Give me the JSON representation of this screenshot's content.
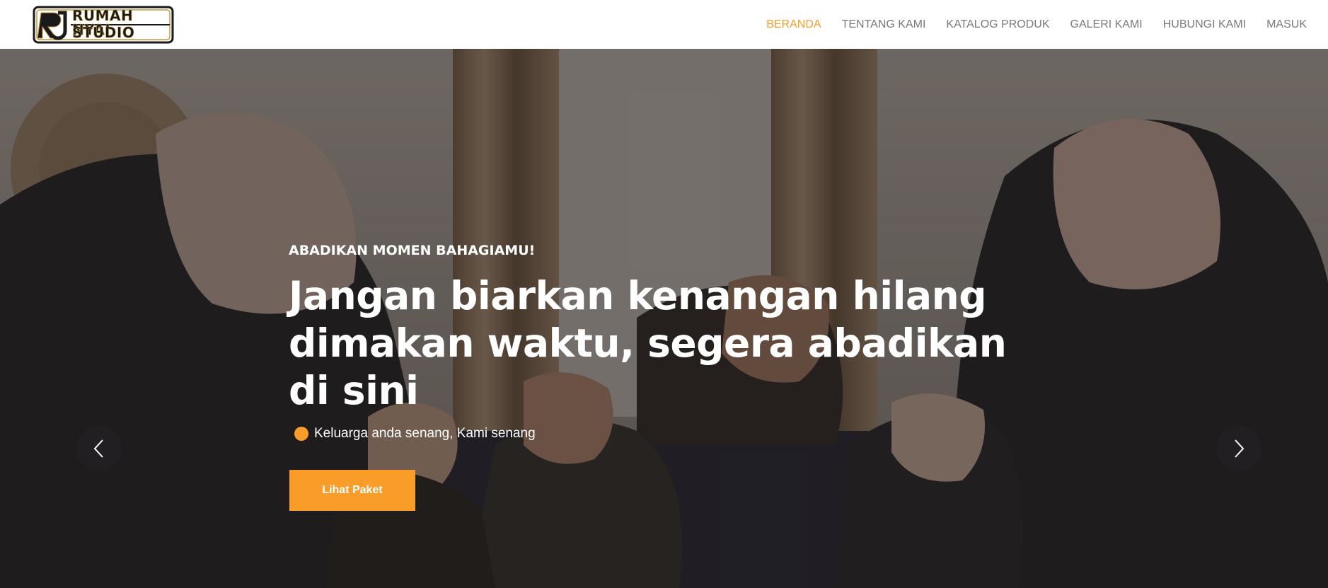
{
  "brand": {
    "logo_line1": "RUMAH NYAI",
    "logo_line2": "STUDIO",
    "accent_color": "#f99d28"
  },
  "nav": {
    "items": [
      {
        "label": "BERANDA",
        "active": true
      },
      {
        "label": "TENTANG KAMI",
        "active": false
      },
      {
        "label": "KATALOG PRODUK",
        "active": false
      },
      {
        "label": "GALERI KAMI",
        "active": false
      },
      {
        "label": "HUBUNGI KAMI",
        "active": false
      },
      {
        "label": "MASUK",
        "active": false
      }
    ]
  },
  "hero": {
    "kicker": "ABADIKAN MOMEN BAHAGIAMU!",
    "title": "Jangan biarkan kenangan hilang dimakan waktu, segera abadikan di sini",
    "subtitle": "Keluarga anda senang, Kami senang",
    "cta_label": "Lihat Paket",
    "prev_icon": "chevron-left-icon",
    "next_icon": "chevron-right-icon"
  }
}
